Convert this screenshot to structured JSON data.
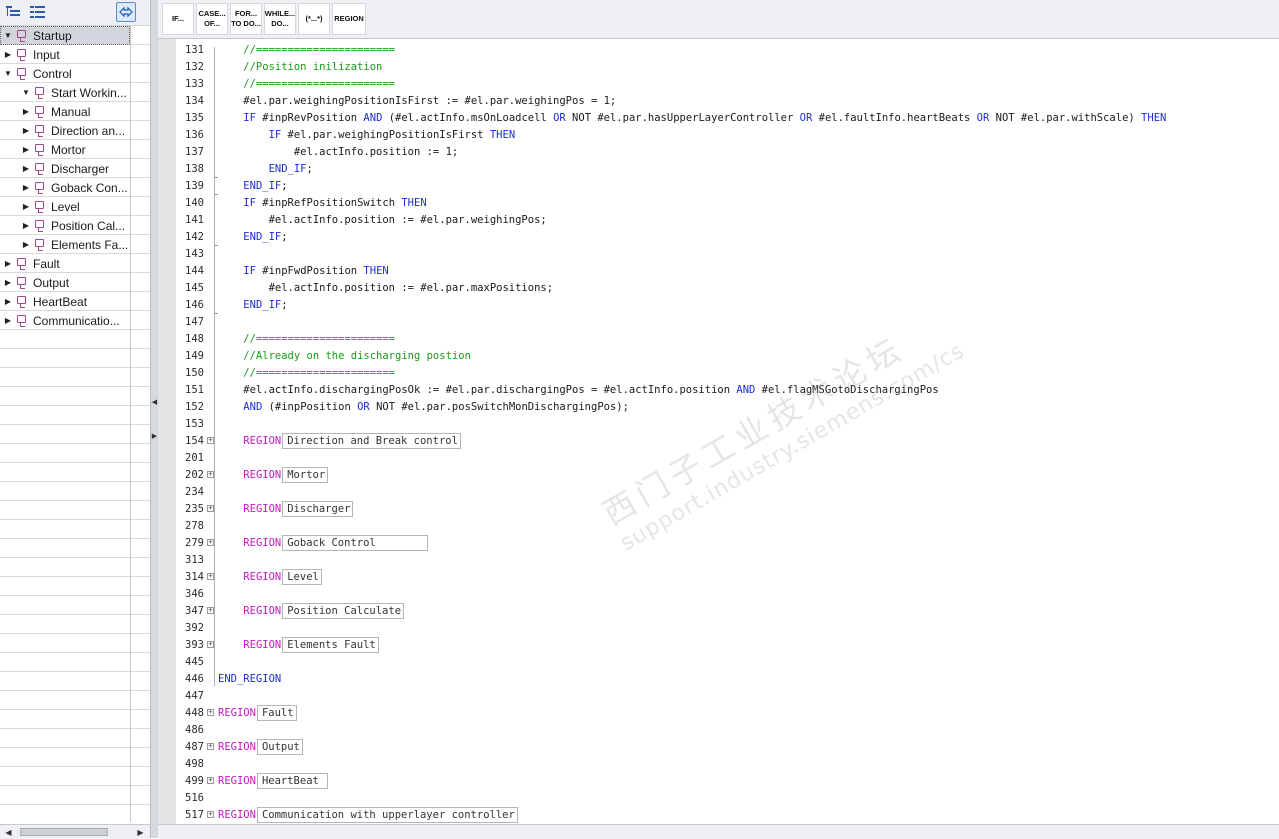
{
  "tree": {
    "items": [
      {
        "label": "Startup",
        "expand": "expanded",
        "selected": true
      },
      {
        "label": "Input",
        "expand": "collapsed"
      },
      {
        "label": "Control",
        "expand": "expanded"
      },
      {
        "label": "Start Workin...",
        "expand": "expanded"
      },
      {
        "label": "Manual",
        "expand": "collapsed"
      },
      {
        "label": "Direction an...",
        "expand": "collapsed"
      },
      {
        "label": "Mortor",
        "expand": "collapsed"
      },
      {
        "label": "Discharger",
        "expand": "collapsed"
      },
      {
        "label": "Goback Con...",
        "expand": "collapsed"
      },
      {
        "label": "Level",
        "expand": "collapsed"
      },
      {
        "label": "Position Cal...",
        "expand": "collapsed"
      },
      {
        "label": "Elements Fa...",
        "expand": "collapsed"
      },
      {
        "label": "Fault",
        "expand": "collapsed"
      },
      {
        "label": "Output",
        "expand": "collapsed"
      },
      {
        "label": "HeartBeat",
        "expand": "collapsed"
      },
      {
        "label": "Communicatio...",
        "expand": "collapsed"
      }
    ]
  },
  "instructions": [
    "IF...",
    "CASE...\nOF...",
    "FOR...\nTO DO...",
    "WHILE...\nDO...",
    "(*...*)",
    "REGION"
  ],
  "code": {
    "lines": [
      {
        "n": "131",
        "tokens": [
          [
            "cm",
            "    //======================"
          ]
        ]
      },
      {
        "n": "132",
        "tokens": [
          [
            "cm",
            "    //Position inilization"
          ]
        ]
      },
      {
        "n": "133",
        "tokens": [
          [
            "cm",
            "    //======================"
          ]
        ]
      },
      {
        "n": "134",
        "tokens": [
          [
            "",
            "    #el.par.weighingPositionIsFirst := #el.par.weighingPos = 1;"
          ]
        ]
      },
      {
        "n": "135",
        "tokens": [
          [
            "",
            "    "
          ],
          [
            "kw",
            "IF"
          ],
          [
            "",
            " #inpRevPosition "
          ],
          [
            "kw",
            "AND"
          ],
          [
            "",
            " (#el.actInfo.msOnLoadcell "
          ],
          [
            "kw",
            "OR"
          ],
          [
            "",
            " NOT #el.par.hasUpperLayerController "
          ],
          [
            "kw",
            "OR"
          ],
          [
            "",
            " #el.faultInfo.heartBeats "
          ],
          [
            "kw",
            "OR"
          ],
          [
            "",
            " NOT #el.par.withScale) "
          ],
          [
            "kw",
            "THEN"
          ]
        ]
      },
      {
        "n": "136",
        "tokens": [
          [
            "",
            "        "
          ],
          [
            "kw",
            "IF"
          ],
          [
            "",
            " #el.par.weighingPositionIsFirst "
          ],
          [
            "kw",
            "THEN"
          ]
        ]
      },
      {
        "n": "137",
        "tokens": [
          [
            "",
            "            #el.actInfo.position := 1;"
          ]
        ]
      },
      {
        "n": "138",
        "tokens": [
          [
            "",
            "        "
          ],
          [
            "kw",
            "END_IF"
          ],
          [
            "",
            ";"
          ]
        ]
      },
      {
        "n": "139",
        "tokens": [
          [
            "",
            "    "
          ],
          [
            "kw",
            "END_IF"
          ],
          [
            "",
            ";"
          ]
        ]
      },
      {
        "n": "140",
        "tokens": [
          [
            "",
            "    "
          ],
          [
            "kw",
            "IF"
          ],
          [
            "",
            " #inpRefPositionSwitch "
          ],
          [
            "kw",
            "THEN"
          ]
        ]
      },
      {
        "n": "141",
        "tokens": [
          [
            "",
            "        #el.actInfo.position := #el.par.weighingPos;"
          ]
        ]
      },
      {
        "n": "142",
        "tokens": [
          [
            "",
            "    "
          ],
          [
            "kw",
            "END_IF"
          ],
          [
            "",
            ";"
          ]
        ]
      },
      {
        "n": "143",
        "tokens": []
      },
      {
        "n": "144",
        "tokens": [
          [
            "",
            "    "
          ],
          [
            "kw",
            "IF"
          ],
          [
            "",
            " #inpFwdPosition "
          ],
          [
            "kw",
            "THEN"
          ]
        ]
      },
      {
        "n": "145",
        "tokens": [
          [
            "",
            "        #el.actInfo.position := #el.par.maxPositions;"
          ]
        ]
      },
      {
        "n": "146",
        "tokens": [
          [
            "",
            "    "
          ],
          [
            "kw",
            "END_IF"
          ],
          [
            "",
            ";"
          ]
        ]
      },
      {
        "n": "147",
        "tokens": []
      },
      {
        "n": "148",
        "tokens": [
          [
            "cm",
            "    //======================"
          ]
        ]
      },
      {
        "n": "149",
        "tokens": [
          [
            "cm",
            "    //Already on the discharging postion"
          ]
        ]
      },
      {
        "n": "150",
        "tokens": [
          [
            "cm",
            "    //======================"
          ]
        ]
      },
      {
        "n": "151",
        "tokens": [
          [
            "",
            "    #el.actInfo.dischargingPosOk := #el.par.dischargingPos = #el.actInfo.position "
          ],
          [
            "kw",
            "AND"
          ],
          [
            "",
            " #el.flagMSGotoDischargingPos"
          ]
        ]
      },
      {
        "n": "152",
        "tokens": [
          [
            "",
            "    "
          ],
          [
            "kw",
            "AND"
          ],
          [
            "",
            " (#inpPosition "
          ],
          [
            "kw",
            "OR"
          ],
          [
            "",
            " NOT #el.par.posSwitchMonDischargingPos);"
          ]
        ]
      },
      {
        "n": "153",
        "tokens": []
      },
      {
        "n": "154",
        "fold": "+",
        "tokens": [
          [
            "",
            "    "
          ],
          [
            "rg",
            "REGION"
          ],
          [
            "rgname",
            "Direction and Break control"
          ]
        ]
      },
      {
        "n": "201",
        "tokens": []
      },
      {
        "n": "202",
        "fold": "+",
        "tokens": [
          [
            "",
            "    "
          ],
          [
            "rg",
            "REGION"
          ],
          [
            "rgname",
            "Mortor"
          ]
        ]
      },
      {
        "n": "234",
        "tokens": []
      },
      {
        "n": "235",
        "fold": "+",
        "tokens": [
          [
            "",
            "    "
          ],
          [
            "rg",
            "REGION"
          ],
          [
            "rgname",
            "Discharger"
          ]
        ]
      },
      {
        "n": "278",
        "tokens": []
      },
      {
        "n": "279",
        "fold": "+",
        "tokens": [
          [
            "",
            "    "
          ],
          [
            "rg",
            "REGION"
          ],
          [
            "rgname wide",
            "Goback Control"
          ]
        ]
      },
      {
        "n": "313",
        "tokens": []
      },
      {
        "n": "314",
        "fold": "+",
        "tokens": [
          [
            "",
            "    "
          ],
          [
            "rg",
            "REGION"
          ],
          [
            "rgname",
            "Level"
          ]
        ]
      },
      {
        "n": "346",
        "tokens": []
      },
      {
        "n": "347",
        "fold": "+",
        "tokens": [
          [
            "",
            "    "
          ],
          [
            "rg",
            "REGION"
          ],
          [
            "rgname",
            "Position Calculate"
          ]
        ]
      },
      {
        "n": "392",
        "tokens": []
      },
      {
        "n": "393",
        "fold": "+",
        "tokens": [
          [
            "",
            "    "
          ],
          [
            "rg",
            "REGION"
          ],
          [
            "rgname",
            "Elements Fault"
          ]
        ]
      },
      {
        "n": "445",
        "tokens": []
      },
      {
        "n": "446",
        "tokens": [
          [
            "kw",
            "END_REGION"
          ]
        ]
      },
      {
        "n": "447",
        "tokens": []
      },
      {
        "n": "448",
        "fold": "+",
        "tokens": [
          [
            "rg",
            "REGION"
          ],
          [
            "rgname",
            "Fault"
          ]
        ]
      },
      {
        "n": "486",
        "tokens": []
      },
      {
        "n": "487",
        "fold": "+",
        "tokens": [
          [
            "rg",
            "REGION"
          ],
          [
            "rgname",
            "Output"
          ]
        ]
      },
      {
        "n": "498",
        "tokens": []
      },
      {
        "n": "499",
        "fold": "+",
        "tokens": [
          [
            "rg",
            "REGION"
          ],
          [
            "rgname",
            "HeartBeat "
          ]
        ]
      },
      {
        "n": "516",
        "tokens": []
      },
      {
        "n": "517",
        "fold": "+",
        "tokens": [
          [
            "rg",
            "REGION"
          ],
          [
            "rgname",
            "Communication with upperlayer controller"
          ]
        ]
      }
    ]
  },
  "watermark": {
    "line1": "西门子工业技术论坛",
    "line2": "support.industry.siemens.com/cs"
  }
}
